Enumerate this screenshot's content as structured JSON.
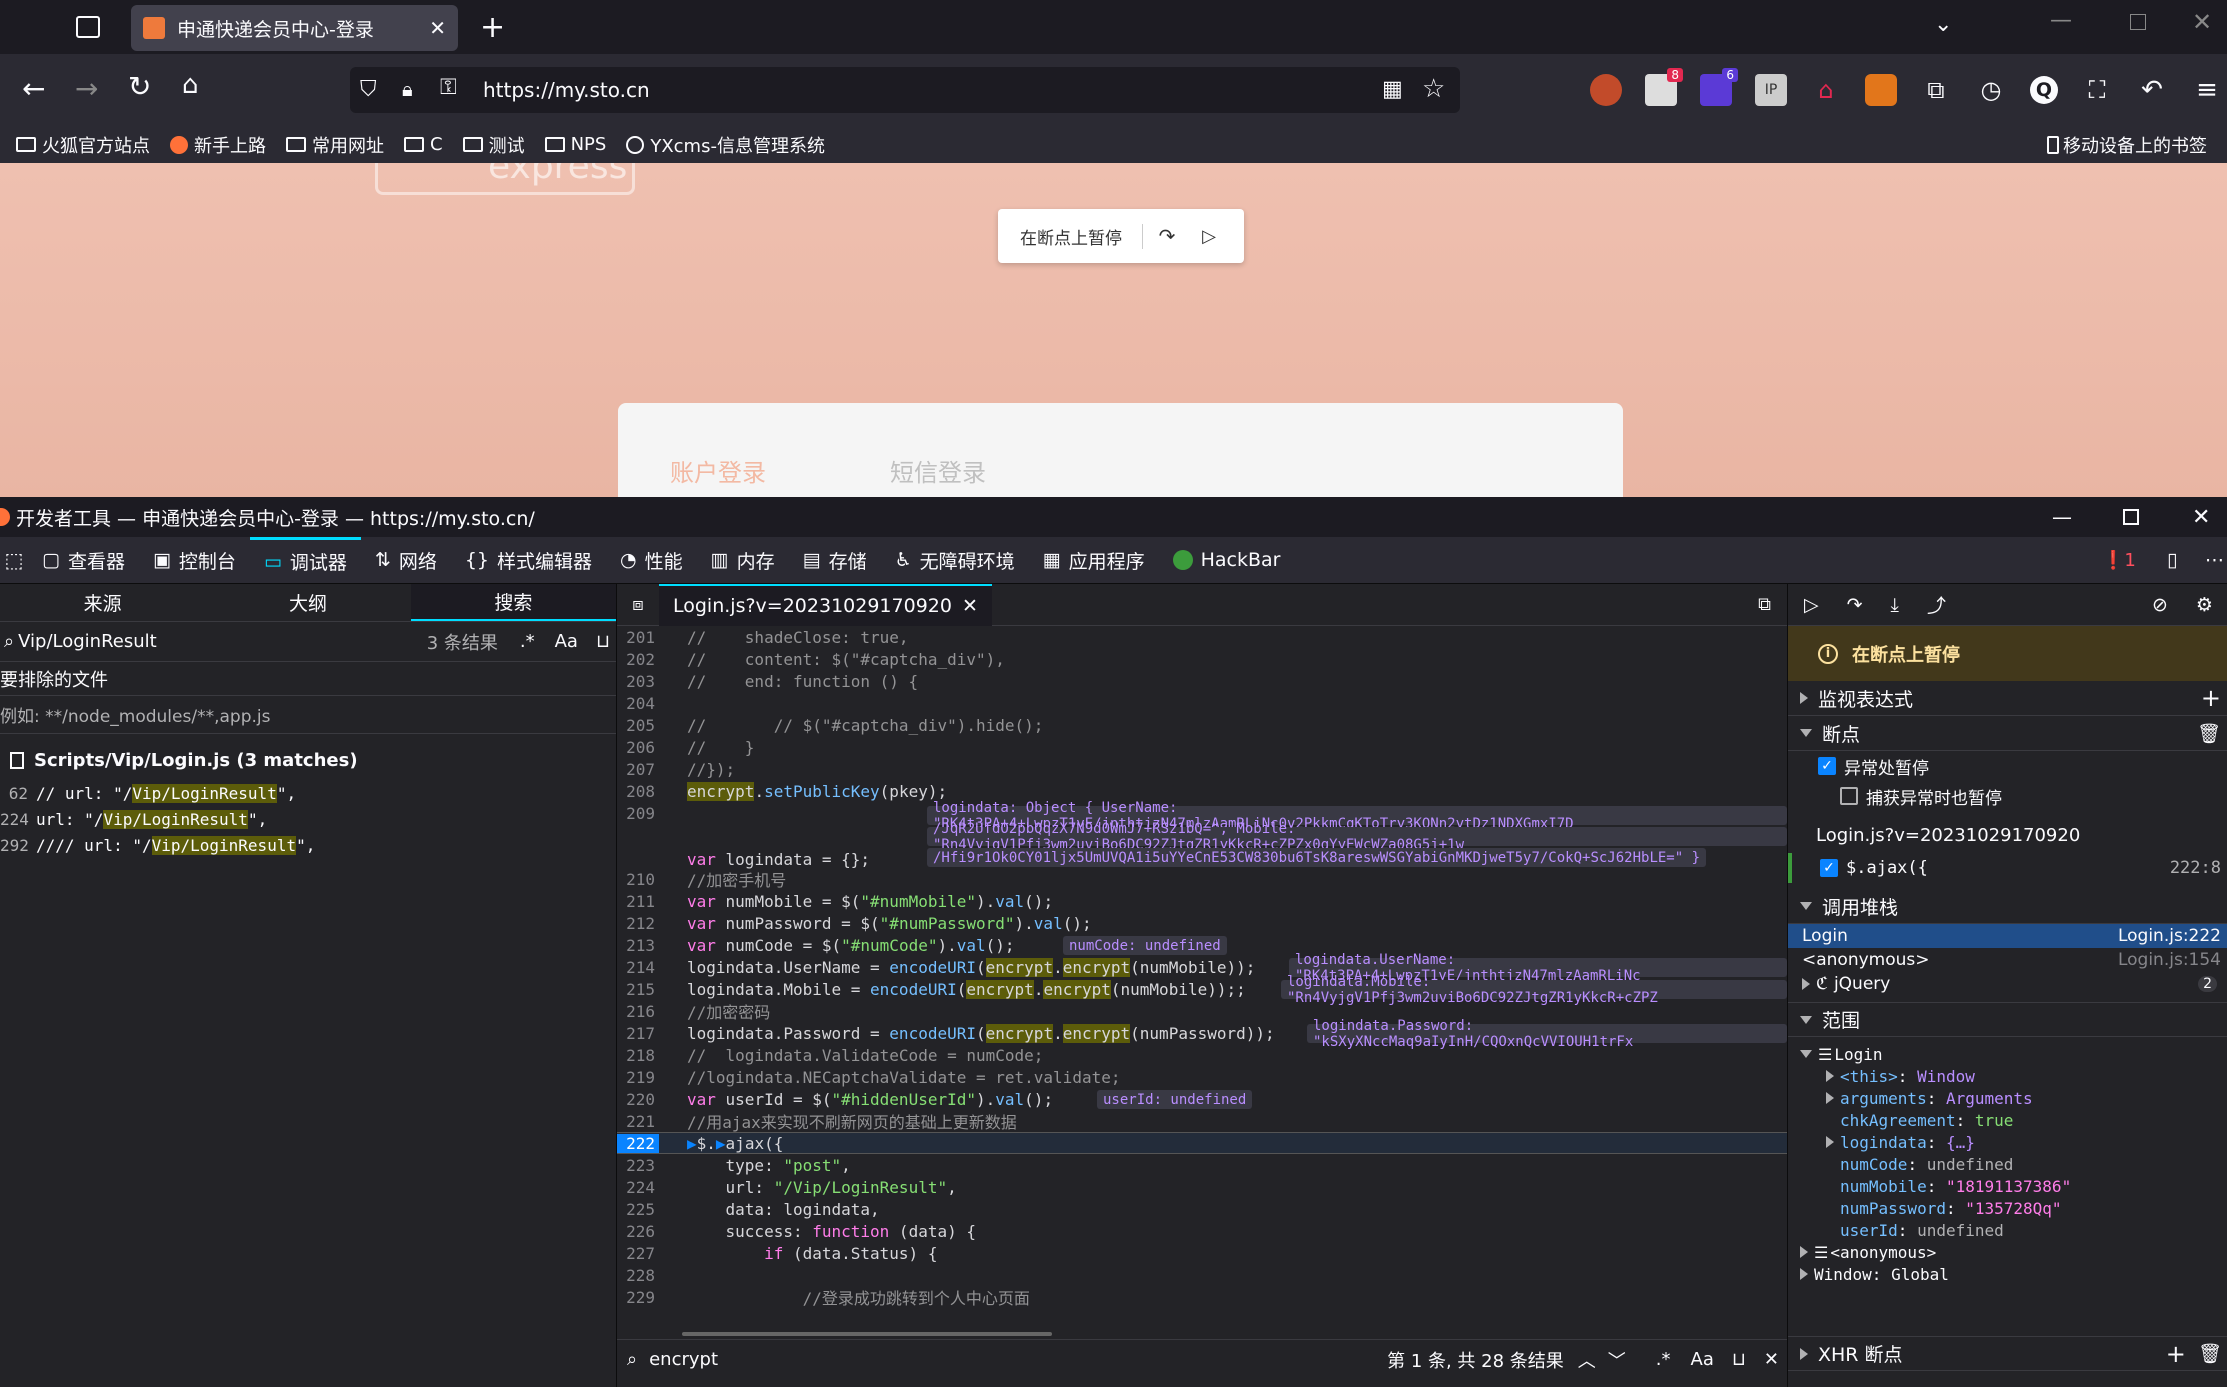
{
  "browser": {
    "tab_title": "申通快递会员中心-登录",
    "url": "https://my.sto.cn",
    "bookmarks": [
      "火狐官方站点",
      "新手上路",
      "常用网址",
      "C",
      "测试",
      "NPS",
      "YXcms-信息管理系统"
    ],
    "mobile_bookmarks": "移动设备上的书签",
    "badge1": "8",
    "badge2": "6"
  },
  "page": {
    "paused_label": "在断点上暂停",
    "tab_account": "账户登录",
    "tab_sms": "短信登录"
  },
  "devtools": {
    "title": "开发者工具 — 申通快递会员中心-登录 — https://my.sto.cn/",
    "tabs": [
      "查看器",
      "控制台",
      "调试器",
      "网络",
      "样式编辑器",
      "性能",
      "内存",
      "存储",
      "无障碍环境",
      "应用程序",
      "HackBar"
    ],
    "error_count": "1",
    "left": {
      "subtabs": [
        "来源",
        "大纲",
        "搜索"
      ],
      "search_value": "Vip/LoginResult",
      "result_count": "3 条结果",
      "exclude_label": "要排除的文件",
      "exclude_placeholder": "例如: **/node_modules/**,app.js",
      "file": "Scripts/Vip/Login.js (3 matches)",
      "matches": [
        {
          "line": "62",
          "pre": "// url: \"/",
          "hit": "Vip/LoginResult",
          "post": "\","
        },
        {
          "line": "224",
          "pre": "url: \"/",
          "hit": "Vip/LoginResult",
          "post": "\","
        },
        {
          "line": "292",
          "pre": "//// url: \"/",
          "hit": "Vip/LoginResult",
          "post": "\","
        }
      ]
    },
    "editor": {
      "file_tab": "Login.js?v=20231029170920",
      "search_value": "encrypt",
      "search_status": "第 1 条, 共 28 条结果"
    },
    "right": {
      "paused": "在断点上暂停",
      "watch": "监视表达式",
      "breakpoints": "断点",
      "pause_exceptions": "异常处暂停",
      "pause_caught": "捕获异常时也暂停",
      "bp_file": "Login.js?v=20231029170920",
      "bp_code": "$.ajax({",
      "bp_loc": "222:8",
      "callstack": "调用堆栈",
      "frames": [
        {
          "name": "Login",
          "loc": "Login.js:222"
        },
        {
          "name": "<anonymous>",
          "loc": "Login.js:154"
        },
        {
          "name": "jQuery",
          "loc": "2"
        }
      ],
      "scopes": "范围",
      "scope_login": "Login",
      "scope_vars": [
        {
          "k": "<this>",
          "v": "Window"
        },
        {
          "k": "arguments",
          "v": "Arguments"
        },
        {
          "k": "chkAgreement",
          "v": "true"
        },
        {
          "k": "logindata",
          "v": "{…}"
        },
        {
          "k": "numCode",
          "v": "undefined"
        },
        {
          "k": "numMobile",
          "v": "\"18191137386\""
        },
        {
          "k": "numPassword",
          "v": "\"135728Qq\""
        },
        {
          "k": "userId",
          "v": "undefined"
        }
      ],
      "scope_anon": "<anonymous>",
      "scope_window": "Window: Global",
      "xhr": "XHR 断点"
    }
  }
}
